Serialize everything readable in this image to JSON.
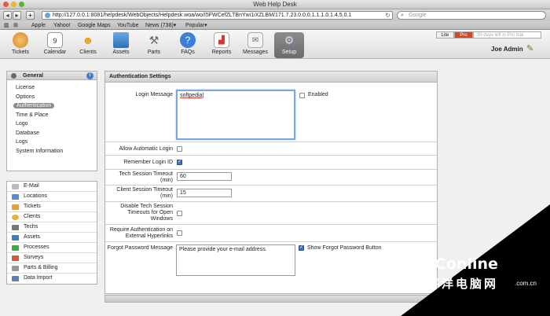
{
  "window": {
    "title": "Web Help Desk"
  },
  "browser": {
    "url": "http://127.0.0.1:8081/helpdesk/WebObjects/Helpdesk.woa/wo/I5FWCefZLTBnYwi1iXZLBM/171.7.23.0.0.0.1.1.1.0.1.4.5.0.1",
    "search_placeholder": "Google",
    "bookmarks": [
      "Apple",
      "Yahoo!",
      "Google Maps",
      "YouTube",
      "News (738)▾",
      "Popular▾"
    ]
  },
  "nav": {
    "items": [
      {
        "label": "Tickets",
        "icon": "tickets-icon"
      },
      {
        "label": "Calendar",
        "icon": "calendar-icon"
      },
      {
        "label": "Clients",
        "icon": "clients-icon"
      },
      {
        "label": "Assets",
        "icon": "assets-icon"
      },
      {
        "label": "Parts",
        "icon": "parts-icon"
      },
      {
        "label": "FAQs",
        "icon": "faq-icon"
      },
      {
        "label": "Reports",
        "icon": "reports-icon"
      },
      {
        "label": "Messages",
        "icon": "messages-icon"
      },
      {
        "label": "Setup",
        "icon": "setup-icon"
      }
    ],
    "active": "Setup",
    "calendar_day": "9"
  },
  "license": {
    "lite": "Lite",
    "pro": "Pro",
    "trial": "30 days left in Pro trial"
  },
  "user": {
    "name": "Joe Admin"
  },
  "sidebar": {
    "section": "General",
    "links": [
      "License",
      "Options",
      "Authentication",
      "Time & Place",
      "Logo",
      "Database",
      "Logs",
      "System Information"
    ],
    "selected": "Authentication",
    "categories": [
      "E-Mail",
      "Locations",
      "Tickets",
      "Clients",
      "Techs",
      "Assets",
      "Processes",
      "Surveys",
      "Parts & Billing",
      "Data Import"
    ]
  },
  "panel": {
    "title": "Authentication Settings",
    "login_message": {
      "label": "Login Message",
      "value": "softpedia",
      "enabled_label": "Enabled",
      "enabled": false
    },
    "allow_auto_login": {
      "label": "Allow Automatic Login",
      "checked": false
    },
    "remember_login": {
      "label": "Remember Login ID",
      "checked": true
    },
    "tech_timeout": {
      "label_1": "Tech Session Timeout",
      "label_2": "(min)",
      "value": "60"
    },
    "client_timeout": {
      "label_1": "Client Session Timeout",
      "label_2": "(min)",
      "value": "15"
    },
    "disable_tech_timeouts": {
      "label_1": "Disable Tech Session",
      "label_2": "Timeouts for Open",
      "label_3": "Windows",
      "checked": false
    },
    "require_auth": {
      "label_1": "Require Authentication on",
      "label_2": "External Hyperlinks",
      "checked": false
    },
    "forgot_password": {
      "label": "Forgot Password Message",
      "value": "Please provide your e-mail address.",
      "show_button_label": "Show Forgot Password Button",
      "show_button": true
    }
  },
  "watermark": {
    "brand": "PConline",
    "cn_name": "太平洋电脑网",
    "domain_suffix": ".com.cn"
  }
}
